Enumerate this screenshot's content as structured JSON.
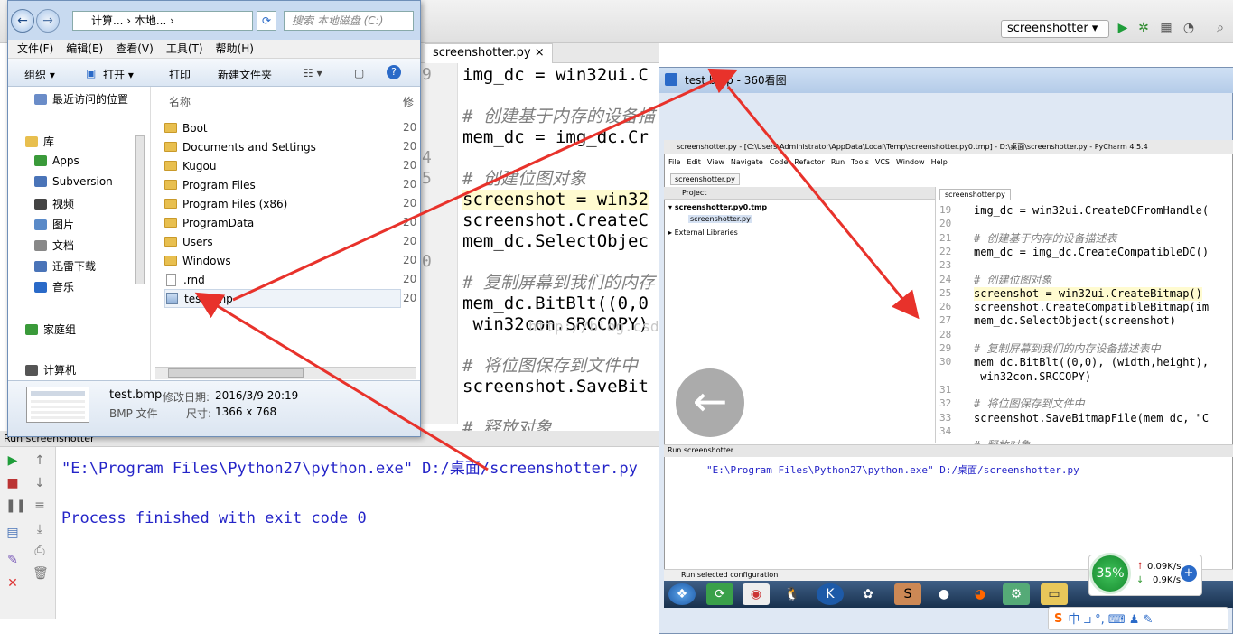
{
  "ide": {
    "run_config": "screenshotter",
    "editor_tab": "screenshotter.py",
    "line_numbers": [
      "9",
      "",
      "",
      "",
      "4",
      "5",
      "",
      "",
      "",
      "0",
      "",
      "",
      ""
    ],
    "code_lines": [
      {
        "text": "img_dc = win32ui.C",
        "kind": "code"
      },
      {
        "text": "",
        "kind": "code"
      },
      {
        "text": "# 创建基于内存的设备描",
        "kind": "comment"
      },
      {
        "text": "mem_dc = img_dc.Cr",
        "kind": "code"
      },
      {
        "text": "",
        "kind": "code"
      },
      {
        "text": "# 创建位图对象",
        "kind": "comment"
      },
      {
        "text": "screenshot = win32",
        "kind": "highlight"
      },
      {
        "text": "screenshot.CreateC",
        "kind": "code"
      },
      {
        "text": "mem_dc.SelectObjec",
        "kind": "code"
      },
      {
        "text": "",
        "kind": "code"
      },
      {
        "text": "# 复制屏幕到我们的内存",
        "kind": "comment"
      },
      {
        "text": "mem_dc.BitBlt((0,0",
        "kind": "code"
      },
      {
        "text": " win32con.SRCCOPY)",
        "kind": "code"
      },
      {
        "text": "",
        "kind": "code"
      },
      {
        "text": "# 将位图保存到文件中",
        "kind": "comment"
      },
      {
        "text": "screenshot.SaveBit",
        "kind": "code"
      },
      {
        "text": "",
        "kind": "code"
      },
      {
        "text": "# 释放对象",
        "kind": "comment"
      }
    ],
    "run_header": "Run  screenshotter",
    "console_line1": "\"E:\\Program Files\\Python27\\python.exe\" D:/桌面/screenshotter.py",
    "console_line2": "Process finished with exit code 0",
    "watermark": "http://blog.csdn.net/"
  },
  "explorer": {
    "address": "计算... › 本地... ›",
    "search_placeholder": "搜索 本地磁盘 (C:)",
    "menu": [
      "文件(F)",
      "编辑(E)",
      "查看(V)",
      "工具(T)",
      "帮助(H)"
    ],
    "commands": {
      "organize": "组织 ▾",
      "open": "打开 ▾",
      "print": "打印",
      "new_folder": "新建文件夹"
    },
    "column_name": "名称",
    "column_mod": "修",
    "nav": [
      {
        "label": "最近访问的位置",
        "color": "#6a8cc8"
      },
      {
        "label": "库",
        "color": "#e8bf4f"
      },
      {
        "label": "Apps",
        "color": "#3a9a3a"
      },
      {
        "label": "Subversion",
        "color": "#4a74b8"
      },
      {
        "label": "视频",
        "color": "#444444"
      },
      {
        "label": "图片",
        "color": "#5a8ac8"
      },
      {
        "label": "文档",
        "color": "#888888"
      },
      {
        "label": "迅雷下载",
        "color": "#4a74b8"
      },
      {
        "label": "音乐",
        "color": "#2a6ac8"
      },
      {
        "label": "家庭组",
        "color": "#3a9a3a"
      },
      {
        "label": "计算机",
        "color": "#555555"
      }
    ],
    "files": [
      {
        "name": "Boot",
        "type": "folder",
        "date": "20"
      },
      {
        "name": "Documents and Settings",
        "type": "folder",
        "date": "20"
      },
      {
        "name": "Kugou",
        "type": "folder",
        "date": "20"
      },
      {
        "name": "Program Files",
        "type": "folder",
        "date": "20"
      },
      {
        "name": "Program Files (x86)",
        "type": "folder",
        "date": "20"
      },
      {
        "name": "ProgramData",
        "type": "folder",
        "date": "20"
      },
      {
        "name": "Users",
        "type": "folder",
        "date": "20"
      },
      {
        "name": "Windows",
        "type": "folder",
        "date": "20"
      },
      {
        "name": ".rnd",
        "type": "file",
        "date": "20"
      },
      {
        "name": "test.bmp",
        "type": "image",
        "date": "20"
      }
    ],
    "detail": {
      "filename": "test.bmp",
      "mod_label": "修改日期:",
      "mod_value": "2016/3/9 20:19",
      "type": "BMP 文件",
      "size_label": "尺寸:",
      "size_value": "1366 x 768"
    }
  },
  "viewer": {
    "title": "test.bmp - 360看图",
    "shot": {
      "titlebar": "screenshotter.py - [C:\\Users\\Administrator\\AppData\\Local\\Temp\\screenshotter.py0.tmp] - D:\\桌面\\screenshotter.py - PyCharm 4.5.4",
      "menu": [
        "File",
        "Edit",
        "View",
        "Navigate",
        "Code",
        "Refactor",
        "Run",
        "Tools",
        "VCS",
        "Window",
        "Help"
      ],
      "breadcrumb": "screenshotter.py",
      "project_label": "Project",
      "tree": [
        "screenshotter.py0.tmp",
        "screenshotter.py",
        "External Libraries"
      ],
      "tab": "screenshotter.py",
      "lines": [
        {
          "n": "19",
          "t": "img_dc = win32ui.CreateDCFromHandle(",
          "k": "code"
        },
        {
          "n": "20",
          "t": "",
          "k": "code"
        },
        {
          "n": "21",
          "t": "# 创建基于内存的设备描述表",
          "k": "comment"
        },
        {
          "n": "22",
          "t": "mem_dc = img_dc.CreateCompatibleDC()",
          "k": "code"
        },
        {
          "n": "23",
          "t": "",
          "k": "code"
        },
        {
          "n": "24",
          "t": "# 创建位图对象",
          "k": "comment"
        },
        {
          "n": "25",
          "t": "screenshot = win32ui.CreateBitmap()",
          "k": "highlight"
        },
        {
          "n": "26",
          "t": "screenshot.CreateCompatibleBitmap(im",
          "k": "code"
        },
        {
          "n": "27",
          "t": "mem_dc.SelectObject(screenshot)",
          "k": "code"
        },
        {
          "n": "28",
          "t": "",
          "k": "code"
        },
        {
          "n": "29",
          "t": "# 复制屏幕到我们的内存设备描述表中",
          "k": "comment"
        },
        {
          "n": "30",
          "t": "mem_dc.BitBlt((0,0), (width,height),",
          "k": "code"
        },
        {
          "n": "",
          "t": " win32con.SRCCOPY)",
          "k": "code"
        },
        {
          "n": "31",
          "t": "",
          "k": "code"
        },
        {
          "n": "32",
          "t": "# 将位图保存到文件中",
          "k": "comment"
        },
        {
          "n": "33",
          "t": "screenshot.SaveBitmapFile(mem_dc, \"C",
          "k": "code"
        },
        {
          "n": "34",
          "t": "",
          "k": "code"
        },
        {
          "n": "",
          "t": "# 释放对象",
          "k": "comment"
        }
      ],
      "run_header": "Run  screenshotter",
      "console": "\"E:\\Program Files\\Python27\\python.exe\" D:/桌面/screenshotter.py",
      "status": "Run selected configuration"
    },
    "speed": {
      "percent": "35%",
      "up": "0.09K/s",
      "down": "0.9K/s"
    },
    "ime": "中 ⯾ °, ⌨ ♟ ✎"
  },
  "colors": {
    "accent": "#0b57d0",
    "arrow": "#e8322b",
    "green": "#1f9d3a"
  }
}
